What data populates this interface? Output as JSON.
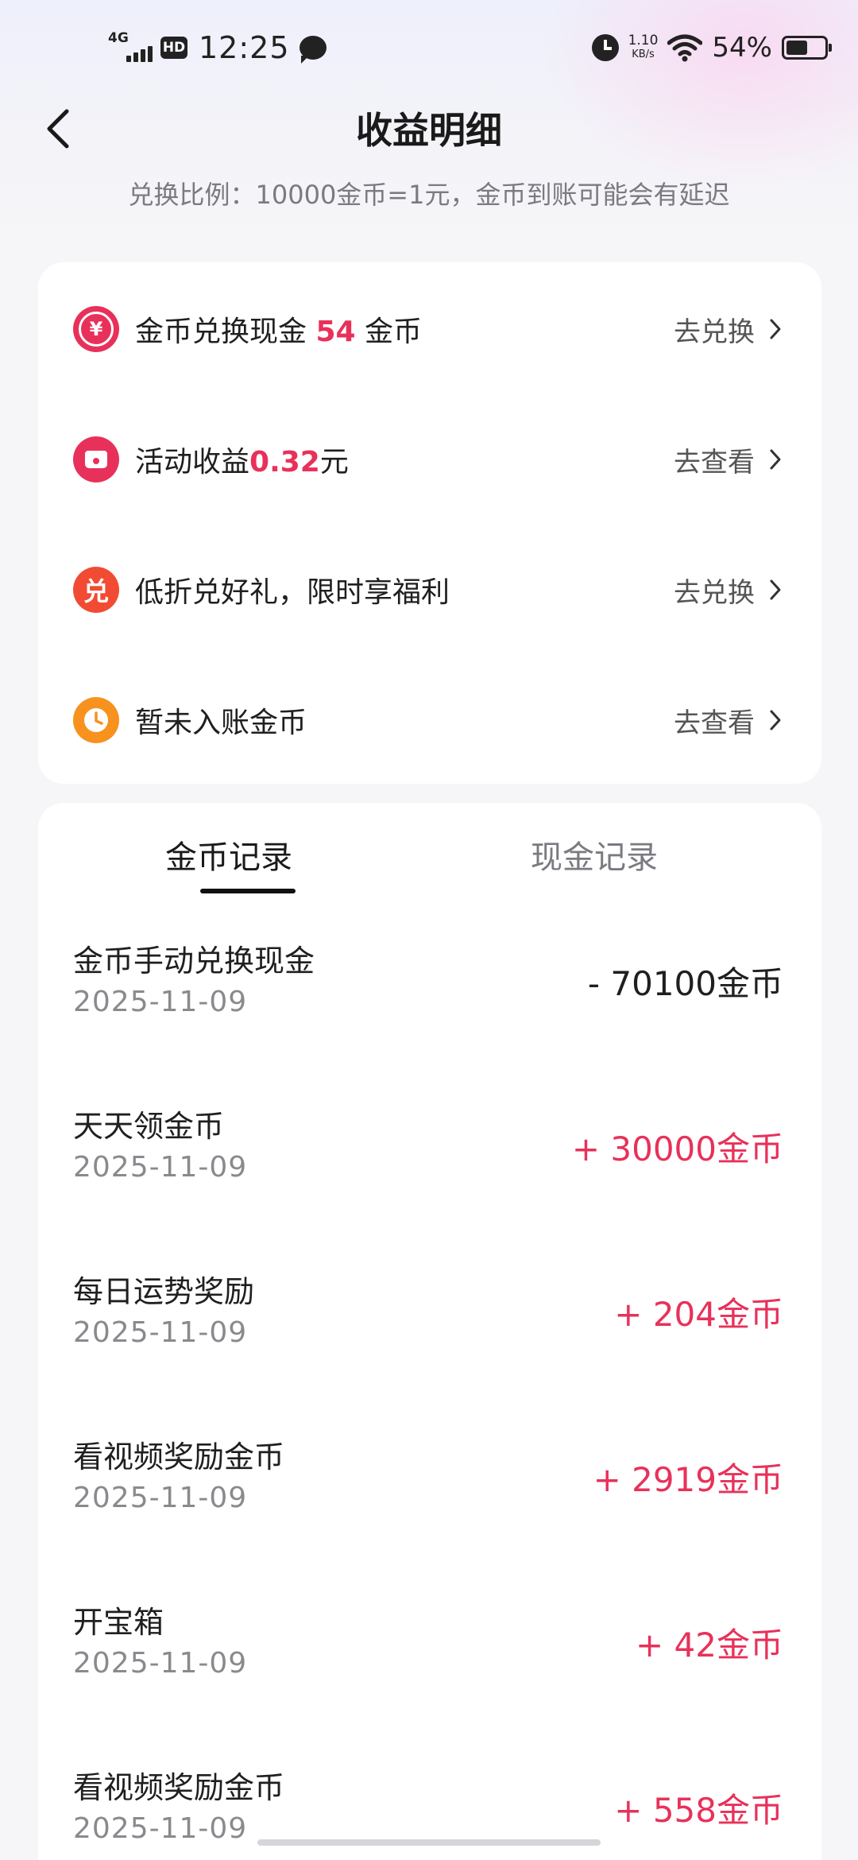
{
  "status_bar": {
    "network": "4G",
    "hd": "HD",
    "time": "12:25",
    "speed_value": "1.10",
    "speed_unit": "KB/s",
    "battery": "54%"
  },
  "header": {
    "title": "收益明细",
    "subtitle": "兑换比例：10000金币=1元，金币到账可能会有延迟"
  },
  "menu": {
    "items": [
      {
        "icon": "yen-coin-icon",
        "icon_text": "¥",
        "color": "#e8315a",
        "label_pre": "金币兑换现金 ",
        "highlight": "54",
        "label_post": " 金币",
        "action": "去兑换"
      },
      {
        "icon": "wallet-icon",
        "icon_text": "",
        "color": "#e8315a",
        "label_pre": "活动收益",
        "highlight": "0.32",
        "label_post": "元",
        "action": "去查看"
      },
      {
        "icon": "exchange-icon",
        "icon_text": "兑",
        "color": "#f24b33",
        "label_pre": "低折兑好礼，限时享福利",
        "highlight": "",
        "label_post": "",
        "action": "去兑换"
      },
      {
        "icon": "clock-icon",
        "icon_text": "",
        "color": "#f7921e",
        "label_pre": "暂未入账金币",
        "highlight": "",
        "label_post": "",
        "action": "去查看"
      }
    ]
  },
  "tabs": {
    "coin": "金币记录",
    "cash": "现金记录",
    "active": "coin"
  },
  "records": [
    {
      "title": "金币手动兑换现金",
      "date": "2025-11-09",
      "amount": "- 70100金币",
      "type": "neg"
    },
    {
      "title": "天天领金币",
      "date": "2025-11-09",
      "amount": "+ 30000金币",
      "type": "pos"
    },
    {
      "title": "每日运势奖励",
      "date": "2025-11-09",
      "amount": "+ 204金币",
      "type": "pos"
    },
    {
      "title": "看视频奖励金币",
      "date": "2025-11-09",
      "amount": "+ 2919金币",
      "type": "pos"
    },
    {
      "title": "开宝箱",
      "date": "2025-11-09",
      "amount": "+ 42金币",
      "type": "pos"
    },
    {
      "title": "看视频奖励金币",
      "date": "2025-11-09",
      "amount": "+ 558金币",
      "type": "pos"
    }
  ],
  "colors": {
    "accent": "#e8315a",
    "orange": "#f7921e"
  }
}
